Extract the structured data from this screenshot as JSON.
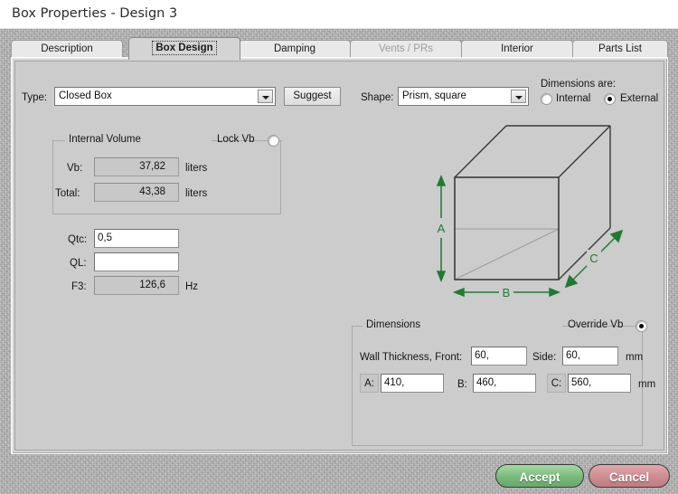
{
  "window": {
    "title": "Box Properties - Design 3"
  },
  "tabs": [
    {
      "label": "Description",
      "state": "normal"
    },
    {
      "label": "Box Design",
      "state": "active"
    },
    {
      "label": "Damping",
      "state": "normal"
    },
    {
      "label": "Vents / PRs",
      "state": "disabled"
    },
    {
      "label": "Interior",
      "state": "normal"
    },
    {
      "label": "Parts List",
      "state": "normal"
    }
  ],
  "toolbar": {
    "type_label": "Type:",
    "type_value": "Closed Box",
    "suggest_label": "Suggest",
    "shape_label": "Shape:",
    "shape_value": "Prism, square",
    "dimensions_are_label": "Dimensions are:",
    "internal_label": "Internal",
    "external_label": "External",
    "internal_checked": false,
    "external_checked": true
  },
  "internal_volume": {
    "group_title": "Internal Volume",
    "lock_vb_label": "Lock Vb",
    "lock_vb_checked": false,
    "vb_label": "Vb:",
    "vb_value": "37,82",
    "vb_unit": "liters",
    "total_label": "Total:",
    "total_value": "43,38",
    "total_unit": "liters"
  },
  "params": {
    "qtc_label": "Qtc:",
    "qtc_value": "0,5",
    "ql_label": "QL:",
    "ql_value": "",
    "f3_label": "F3:",
    "f3_value": "126,6",
    "f3_unit": "Hz"
  },
  "dimensions": {
    "group_title": "Dimensions",
    "override_vb_label": "Override Vb",
    "override_vb_checked": true,
    "wall_thickness_label": "Wall Thickness, Front:",
    "wall_front_value": "60,",
    "side_label": "Side:",
    "wall_side_value": "60,",
    "wall_unit": "mm",
    "a_label": "A:",
    "a_value": "410,",
    "b_label": "B:",
    "b_value": "460,",
    "c_label": "C:",
    "c_value": "560,",
    "abc_unit": "mm"
  },
  "diagram": {
    "label_a": "A",
    "label_b": "B",
    "label_c": "C",
    "line_color": "#3a3a3a",
    "hidden_line_color": "#9a9a9a",
    "dimension_color": "#1f7a32"
  },
  "footer": {
    "accept_label": "Accept",
    "cancel_label": "Cancel",
    "accept_color": "#79b97b",
    "cancel_color": "#cc8b90"
  }
}
